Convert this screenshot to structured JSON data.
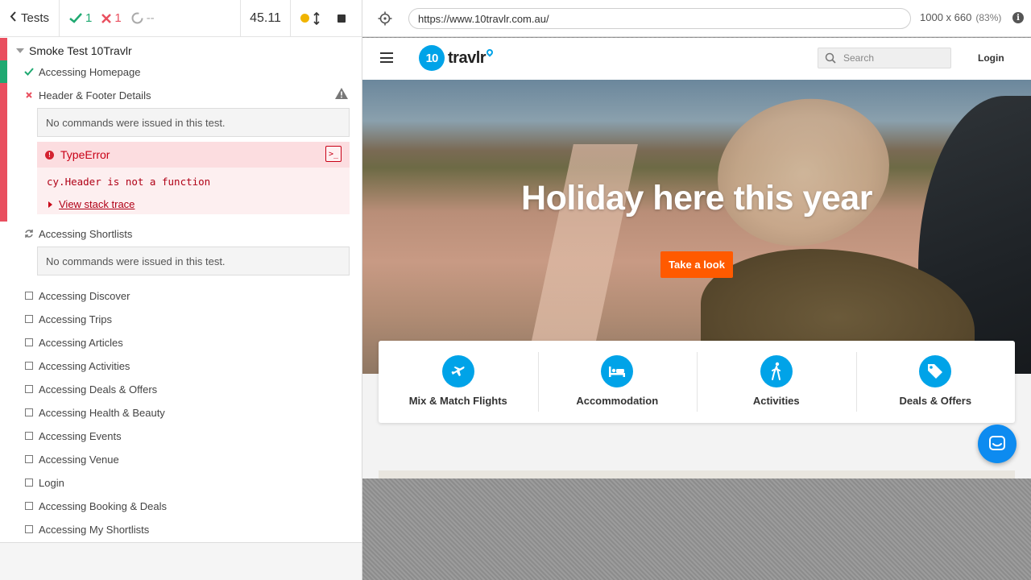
{
  "reporter": {
    "header": {
      "tests_label": "Tests",
      "passed": "1",
      "failed": "1",
      "pending": "--",
      "duration": "45.11"
    },
    "suite_title": "Smoke Test 10Travlr",
    "tests": [
      {
        "label": "Accessing Homepage",
        "state": "passed"
      },
      {
        "label": "Header & Footer Details",
        "state": "failed"
      },
      {
        "label": "Accessing Shortlists",
        "state": "running"
      },
      {
        "label": "Accessing Discover",
        "state": "pending"
      },
      {
        "label": "Accessing Trips",
        "state": "pending"
      },
      {
        "label": "Accessing Articles",
        "state": "pending"
      },
      {
        "label": "Accessing Activities",
        "state": "pending"
      },
      {
        "label": "Accessing Deals & Offers",
        "state": "pending"
      },
      {
        "label": "Accessing Health & Beauty",
        "state": "pending"
      },
      {
        "label": "Accessing Events",
        "state": "pending"
      },
      {
        "label": "Accessing Venue",
        "state": "pending"
      },
      {
        "label": "Login",
        "state": "pending"
      },
      {
        "label": "Accessing Booking & Deals",
        "state": "pending"
      },
      {
        "label": "Accessing My Shortlists",
        "state": "pending"
      }
    ],
    "no_commands_text": "No commands were issued in this test.",
    "error": {
      "name": "TypeError",
      "message": "cy.Header is not a function",
      "stack_link": "View stack trace"
    },
    "colors": {
      "pass": "#1fa971",
      "fail": "#e94f5f",
      "running": "#777777"
    }
  },
  "aut": {
    "url": "https://www.10travlr.com.au/",
    "viewport": "1000 x 660",
    "scale": "(83%)",
    "site": {
      "logo_number": "10",
      "logo_text": "travlr",
      "search_placeholder": "Search",
      "login_label": "Login",
      "hero_title": "Holiday here this year",
      "hero_button": "Take a look",
      "categories": [
        {
          "label": "Mix & Match Flights",
          "icon": "airplane-icon"
        },
        {
          "label": "Accommodation",
          "icon": "bed-icon"
        },
        {
          "label": "Activities",
          "icon": "walking-person-icon"
        },
        {
          "label": "Deals & Offers",
          "icon": "tag-icon"
        }
      ],
      "brand_color": "#00a3e8",
      "cta_color": "#ff5a00"
    }
  }
}
